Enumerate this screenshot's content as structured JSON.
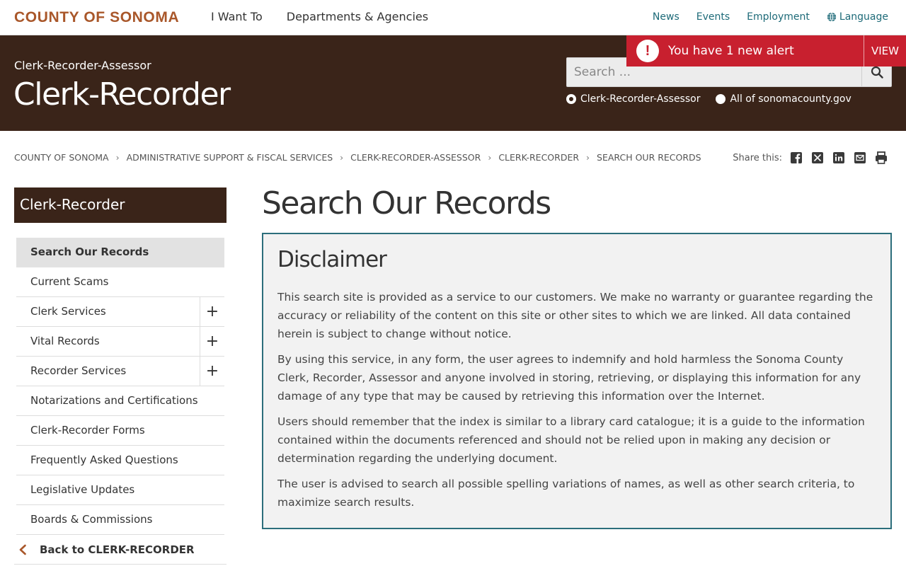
{
  "topbar": {
    "brand": "COUNTY OF SONOMA",
    "main_nav": [
      "I Want To",
      "Departments & Agencies"
    ],
    "util_nav": {
      "news": "News",
      "events": "Events",
      "employment": "Employment",
      "language": "Language"
    }
  },
  "hero": {
    "subtitle": "Clerk-Recorder-Assessor",
    "title": "Clerk-Recorder",
    "search_placeholder": "Search ...",
    "scope_options": [
      {
        "label": "Clerk-Recorder-Assessor",
        "selected": true
      },
      {
        "label": "All of sonomacounty.gov",
        "selected": false
      }
    ]
  },
  "alert": {
    "text": "You have 1 new alert",
    "view_label": "VIEW",
    "icon": "exclamation-icon",
    "color": "#c8202f"
  },
  "breadcrumb": [
    "COUNTY OF SONOMA",
    "ADMINISTRATIVE SUPPORT & FISCAL SERVICES",
    "CLERK-RECORDER-ASSESSOR",
    "CLERK-RECORDER",
    "SEARCH OUR RECORDS"
  ],
  "share": {
    "label": "Share this:",
    "icons": [
      "facebook-icon",
      "x-icon",
      "linkedin-icon",
      "email-icon",
      "print-icon"
    ]
  },
  "sidebar": {
    "title": "Clerk-Recorder",
    "items": [
      {
        "label": "Search Our Records",
        "active": true,
        "expandable": false
      },
      {
        "label": "Current Scams",
        "active": false,
        "expandable": false
      },
      {
        "label": "Clerk Services",
        "active": false,
        "expandable": true
      },
      {
        "label": "Vital Records",
        "active": false,
        "expandable": true
      },
      {
        "label": "Recorder Services",
        "active": false,
        "expandable": true
      },
      {
        "label": "Notarizations and Certifications",
        "active": false,
        "expandable": false
      },
      {
        "label": "Clerk-Recorder Forms",
        "active": false,
        "expandable": false
      },
      {
        "label": "Frequently Asked Questions",
        "active": false,
        "expandable": false
      },
      {
        "label": "Legislative Updates",
        "active": false,
        "expandable": false
      },
      {
        "label": "Boards & Commissions",
        "active": false,
        "expandable": false
      }
    ],
    "back_label": "Back to CLERK-RECORDER"
  },
  "main": {
    "page_title": "Search Our Records",
    "disclaimer": {
      "heading": "Disclaimer",
      "paragraphs": [
        "This search site is provided as a service to our customers. We make no warranty or guarantee regarding the accuracy or reliability of the content on this site or other sites to which we are linked. All data contained herein is subject to change without notice.",
        "By using this service, in any form, the user agrees to indemnify and hold harmless the Sonoma County Clerk, Recorder, Assessor and anyone involved in storing, retrieving, or displaying this information for any damage of any type that may be caused by retrieving this information over the Internet.",
        "Users should remember that the index is similar to a library card catalogue; it is a guide to the information contained within the documents referenced and should not be relied upon in making any decision or determination regarding the underlying document.",
        "The user is advised to search all possible spelling variations of names, as well as other search criteria, to maximize search results."
      ]
    }
  },
  "colors": {
    "brand": "#a9572a",
    "hero_bg": "#3a2419",
    "link": "#1d6a78",
    "disclaimer_border": "#2c6e7b"
  }
}
